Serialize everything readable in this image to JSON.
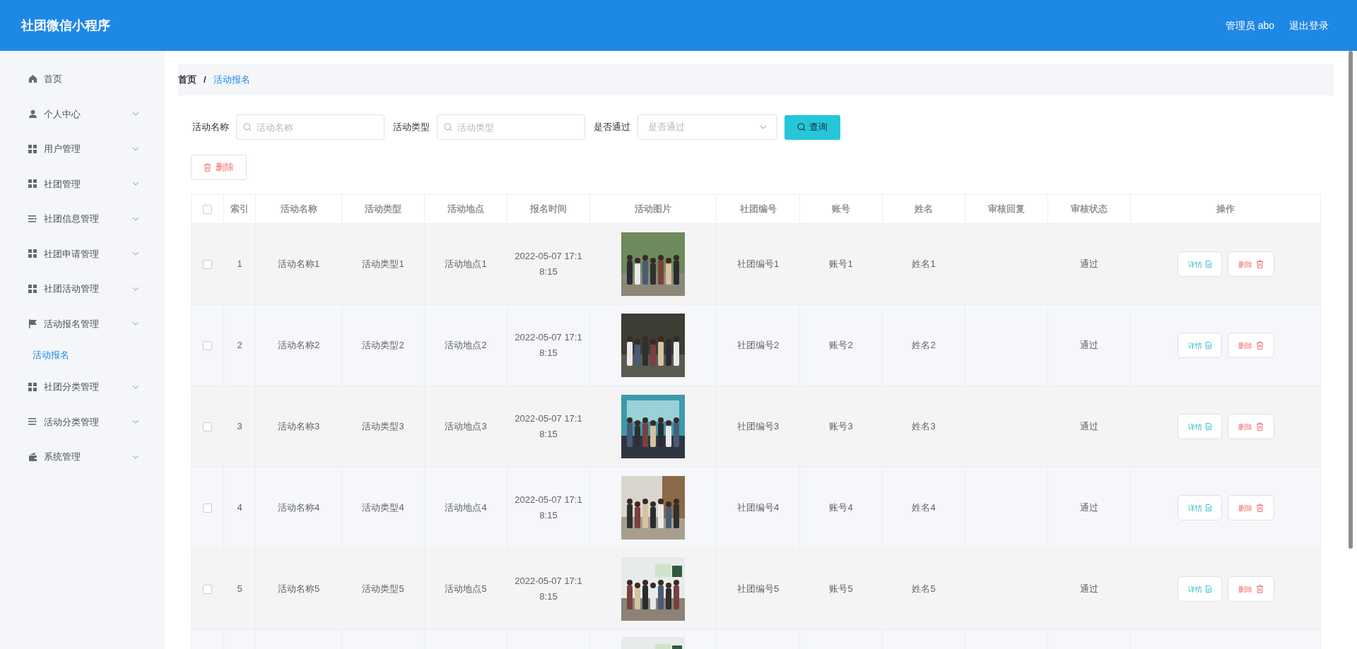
{
  "header": {
    "title": "社团微信小程序",
    "user": "管理员 abo",
    "logout": "退出登录"
  },
  "sidebar": {
    "items": [
      {
        "label": "首页",
        "kind": "home",
        "expandable": false
      },
      {
        "label": "个人中心",
        "kind": "user",
        "expandable": true
      },
      {
        "label": "用户管理",
        "kind": "grid",
        "expandable": true
      },
      {
        "label": "社团管理",
        "kind": "grid",
        "expandable": true
      },
      {
        "label": "社团信息管理",
        "kind": "list",
        "expandable": true
      },
      {
        "label": "社团申请管理",
        "kind": "grid",
        "expandable": true
      },
      {
        "label": "社团活动管理",
        "kind": "grid",
        "expandable": true
      },
      {
        "label": "活动报名管理",
        "kind": "flag",
        "expandable": true,
        "children": [
          {
            "label": "活动报名",
            "selected": true
          }
        ]
      },
      {
        "label": "社团分类管理",
        "kind": "grid",
        "expandable": true
      },
      {
        "label": "活动分类管理",
        "kind": "list",
        "expandable": true
      },
      {
        "label": "系统管理",
        "kind": "wallet",
        "expandable": true
      }
    ]
  },
  "breadcrumb": [
    "首页",
    "活动报名"
  ],
  "breadcrumb_separator": "/",
  "filters": [
    {
      "kind": "text",
      "label": "活动名称",
      "placeholder": "活动名称"
    },
    {
      "kind": "text",
      "label": "活动类型",
      "placeholder": "活动类型"
    },
    {
      "kind": "select",
      "label": "是否通过",
      "placeholder": "是否通过"
    }
  ],
  "search_button": "查询",
  "delete_button": "删除",
  "table": {
    "select_all_checked": false,
    "columns": [
      "索引",
      "活动名称",
      "活动类型",
      "活动地点",
      "报名时间",
      "活动图片",
      "社团编号",
      "账号",
      "姓名",
      "审核回复",
      "审核状态",
      "操作"
    ],
    "rows": [
      {
        "checked": false,
        "index": "1",
        "name": "活动名称1",
        "type": "活动类型1",
        "place": "活动地点1",
        "time": "2022-05-07 17:18:15",
        "image": {
          "kind": "picture"
        },
        "club_no": "社团编号1",
        "account": "账号1",
        "person": "姓名1",
        "status": "通过",
        "actions": [
          "详情",
          "删除"
        ]
      },
      {
        "checked": false,
        "index": "2",
        "name": "活动名称2",
        "type": "活动类型2",
        "place": "活动地点2",
        "time": "2022-05-07 17:18:15",
        "image": {
          "kind": "picture"
        },
        "club_no": "社团编号2",
        "account": "账号2",
        "person": "姓名2",
        "status": "通过",
        "actions": [
          "详情",
          "删除"
        ]
      },
      {
        "checked": false,
        "index": "3",
        "name": "活动名称3",
        "type": "活动类型3",
        "place": "活动地点3",
        "time": "2022-05-07 17:18:15",
        "image": {
          "kind": "picture"
        },
        "club_no": "社团编号3",
        "account": "账号3",
        "person": "姓名3",
        "status": "通过",
        "actions": [
          "详情",
          "删除"
        ]
      },
      {
        "checked": false,
        "index": "4",
        "name": "活动名称4",
        "type": "活动类型4",
        "place": "活动地点4",
        "time": "2022-05-07 17:18:15",
        "image": {
          "kind": "picture"
        },
        "club_no": "社团编号4",
        "account": "账号4",
        "person": "姓名4",
        "status": "通过",
        "actions": [
          "详情",
          "删除"
        ]
      },
      {
        "checked": false,
        "index": "5",
        "name": "活动名称5",
        "type": "活动类型5",
        "place": "活动地点5",
        "time": "2022-05-07 17:18:15",
        "image": {
          "kind": "picture"
        },
        "club_no": "社团编号5",
        "account": "账号5",
        "person": "姓名5",
        "status": "通过",
        "actions": [
          "详情",
          "删除"
        ]
      },
      {
        "image": {
          "kind": "picture"
        }
      }
    ]
  }
}
